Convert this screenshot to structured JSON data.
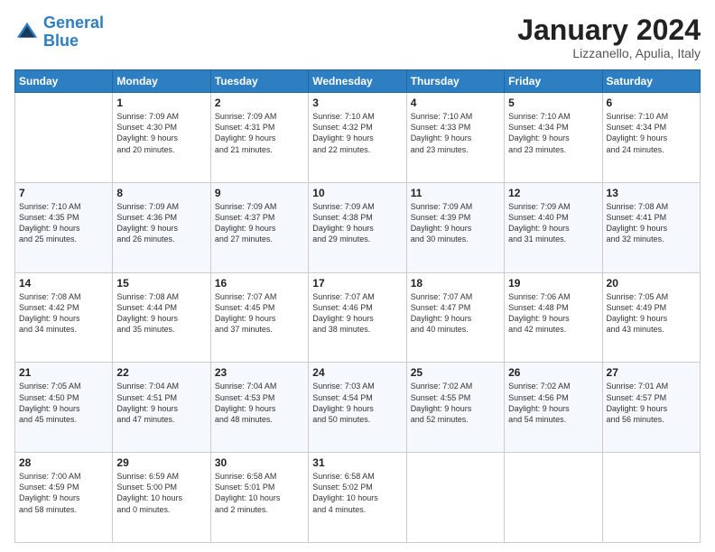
{
  "header": {
    "logo_line1": "General",
    "logo_line2": "Blue",
    "month": "January 2024",
    "location": "Lizzanello, Apulia, Italy"
  },
  "weekdays": [
    "Sunday",
    "Monday",
    "Tuesday",
    "Wednesday",
    "Thursday",
    "Friday",
    "Saturday"
  ],
  "weeks": [
    [
      {
        "day": "",
        "info": ""
      },
      {
        "day": "1",
        "info": "Sunrise: 7:09 AM\nSunset: 4:30 PM\nDaylight: 9 hours\nand 20 minutes."
      },
      {
        "day": "2",
        "info": "Sunrise: 7:09 AM\nSunset: 4:31 PM\nDaylight: 9 hours\nand 21 minutes."
      },
      {
        "day": "3",
        "info": "Sunrise: 7:10 AM\nSunset: 4:32 PM\nDaylight: 9 hours\nand 22 minutes."
      },
      {
        "day": "4",
        "info": "Sunrise: 7:10 AM\nSunset: 4:33 PM\nDaylight: 9 hours\nand 23 minutes."
      },
      {
        "day": "5",
        "info": "Sunrise: 7:10 AM\nSunset: 4:34 PM\nDaylight: 9 hours\nand 23 minutes."
      },
      {
        "day": "6",
        "info": "Sunrise: 7:10 AM\nSunset: 4:34 PM\nDaylight: 9 hours\nand 24 minutes."
      }
    ],
    [
      {
        "day": "7",
        "info": "Sunrise: 7:10 AM\nSunset: 4:35 PM\nDaylight: 9 hours\nand 25 minutes."
      },
      {
        "day": "8",
        "info": "Sunrise: 7:09 AM\nSunset: 4:36 PM\nDaylight: 9 hours\nand 26 minutes."
      },
      {
        "day": "9",
        "info": "Sunrise: 7:09 AM\nSunset: 4:37 PM\nDaylight: 9 hours\nand 27 minutes."
      },
      {
        "day": "10",
        "info": "Sunrise: 7:09 AM\nSunset: 4:38 PM\nDaylight: 9 hours\nand 29 minutes."
      },
      {
        "day": "11",
        "info": "Sunrise: 7:09 AM\nSunset: 4:39 PM\nDaylight: 9 hours\nand 30 minutes."
      },
      {
        "day": "12",
        "info": "Sunrise: 7:09 AM\nSunset: 4:40 PM\nDaylight: 9 hours\nand 31 minutes."
      },
      {
        "day": "13",
        "info": "Sunrise: 7:08 AM\nSunset: 4:41 PM\nDaylight: 9 hours\nand 32 minutes."
      }
    ],
    [
      {
        "day": "14",
        "info": "Sunrise: 7:08 AM\nSunset: 4:42 PM\nDaylight: 9 hours\nand 34 minutes."
      },
      {
        "day": "15",
        "info": "Sunrise: 7:08 AM\nSunset: 4:44 PM\nDaylight: 9 hours\nand 35 minutes."
      },
      {
        "day": "16",
        "info": "Sunrise: 7:07 AM\nSunset: 4:45 PM\nDaylight: 9 hours\nand 37 minutes."
      },
      {
        "day": "17",
        "info": "Sunrise: 7:07 AM\nSunset: 4:46 PM\nDaylight: 9 hours\nand 38 minutes."
      },
      {
        "day": "18",
        "info": "Sunrise: 7:07 AM\nSunset: 4:47 PM\nDaylight: 9 hours\nand 40 minutes."
      },
      {
        "day": "19",
        "info": "Sunrise: 7:06 AM\nSunset: 4:48 PM\nDaylight: 9 hours\nand 42 minutes."
      },
      {
        "day": "20",
        "info": "Sunrise: 7:05 AM\nSunset: 4:49 PM\nDaylight: 9 hours\nand 43 minutes."
      }
    ],
    [
      {
        "day": "21",
        "info": "Sunrise: 7:05 AM\nSunset: 4:50 PM\nDaylight: 9 hours\nand 45 minutes."
      },
      {
        "day": "22",
        "info": "Sunrise: 7:04 AM\nSunset: 4:51 PM\nDaylight: 9 hours\nand 47 minutes."
      },
      {
        "day": "23",
        "info": "Sunrise: 7:04 AM\nSunset: 4:53 PM\nDaylight: 9 hours\nand 48 minutes."
      },
      {
        "day": "24",
        "info": "Sunrise: 7:03 AM\nSunset: 4:54 PM\nDaylight: 9 hours\nand 50 minutes."
      },
      {
        "day": "25",
        "info": "Sunrise: 7:02 AM\nSunset: 4:55 PM\nDaylight: 9 hours\nand 52 minutes."
      },
      {
        "day": "26",
        "info": "Sunrise: 7:02 AM\nSunset: 4:56 PM\nDaylight: 9 hours\nand 54 minutes."
      },
      {
        "day": "27",
        "info": "Sunrise: 7:01 AM\nSunset: 4:57 PM\nDaylight: 9 hours\nand 56 minutes."
      }
    ],
    [
      {
        "day": "28",
        "info": "Sunrise: 7:00 AM\nSunset: 4:59 PM\nDaylight: 9 hours\nand 58 minutes."
      },
      {
        "day": "29",
        "info": "Sunrise: 6:59 AM\nSunset: 5:00 PM\nDaylight: 10 hours\nand 0 minutes."
      },
      {
        "day": "30",
        "info": "Sunrise: 6:58 AM\nSunset: 5:01 PM\nDaylight: 10 hours\nand 2 minutes."
      },
      {
        "day": "31",
        "info": "Sunrise: 6:58 AM\nSunset: 5:02 PM\nDaylight: 10 hours\nand 4 minutes."
      },
      {
        "day": "",
        "info": ""
      },
      {
        "day": "",
        "info": ""
      },
      {
        "day": "",
        "info": ""
      }
    ]
  ]
}
